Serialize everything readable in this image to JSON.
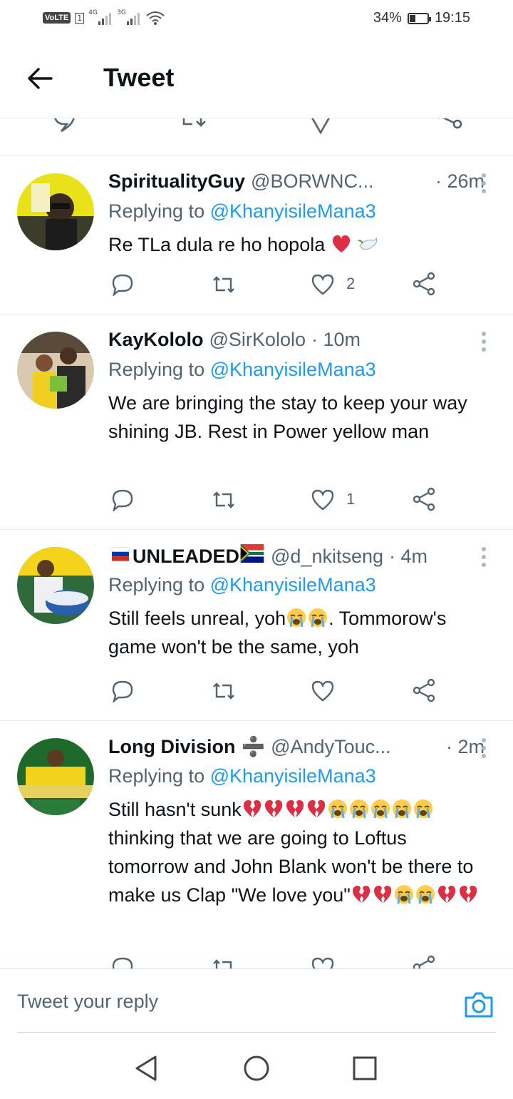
{
  "status_bar": {
    "volte": "VoLTE",
    "sim_index": "1",
    "network_1": "4G",
    "network_2": "3G",
    "battery_percent_label": "34%",
    "battery_level": 0.34,
    "time": "19:15"
  },
  "header": {
    "title": "Tweet",
    "back_icon": "arrow-left-icon"
  },
  "tweets": [
    {
      "name": "SpiritualityGuy",
      "handle": "@BORWNC...",
      "time": "· 26m",
      "replying_prefix": "Replying to ",
      "replying_to": "@KhanyisileMana3",
      "text": "Re TLa dula re ho hopola",
      "emojis_after": [
        "red-heart-emoji",
        "dove-emoji"
      ],
      "likes": "2",
      "avatar_colors": [
        "#e9e21a",
        "#2a2a2a"
      ]
    },
    {
      "name": "KayKololo",
      "handle": "@SirKololo",
      "time": "· 10m",
      "replying_prefix": "Replying to ",
      "replying_to": "@KhanyisileMana3",
      "text": "We are bringing the stay to keep your way shining JB. Rest in Power yellow man",
      "likes": "1",
      "avatar_colors": [
        "#e7d3a8",
        "#2b2b2b"
      ]
    },
    {
      "name_prefix_flag": "russia-flag-emoji",
      "name": "UNLEADED",
      "name_suffix_flag": "south-africa-flag-emoji",
      "handle": "@d_nkitseng",
      "time": "· 4m",
      "replying_prefix": "Replying to ",
      "replying_to": "@KhanyisileMana3",
      "text_part1": "Still feels unreal, yoh",
      "text_part2": ". Tommorow's game won't be the same, yoh",
      "likes": "",
      "avatar_colors": [
        "#f4d41b",
        "#2a5fb0"
      ]
    },
    {
      "name": "Long Division",
      "name_symbol": "➗",
      "handle": "@AndyTouc...",
      "time": "· 2m",
      "replying_prefix": "Replying to ",
      "replying_to": "@KhanyisileMana3",
      "text_part1": "Still hasn't sunk",
      "text_part2": " thinking that we are going to Loftus tomorrow and John Blank won't be there to make us Clap \"We love you\"",
      "avatar_colors": [
        "#1f6a2a",
        "#f2d21d"
      ]
    }
  ],
  "reply_bar": {
    "placeholder": "Tweet your reply",
    "camera_icon": "camera-icon"
  },
  "colors": {
    "accent": "#1d9bf0",
    "secondary_text": "#536471",
    "divider": "#e6ecf0"
  }
}
